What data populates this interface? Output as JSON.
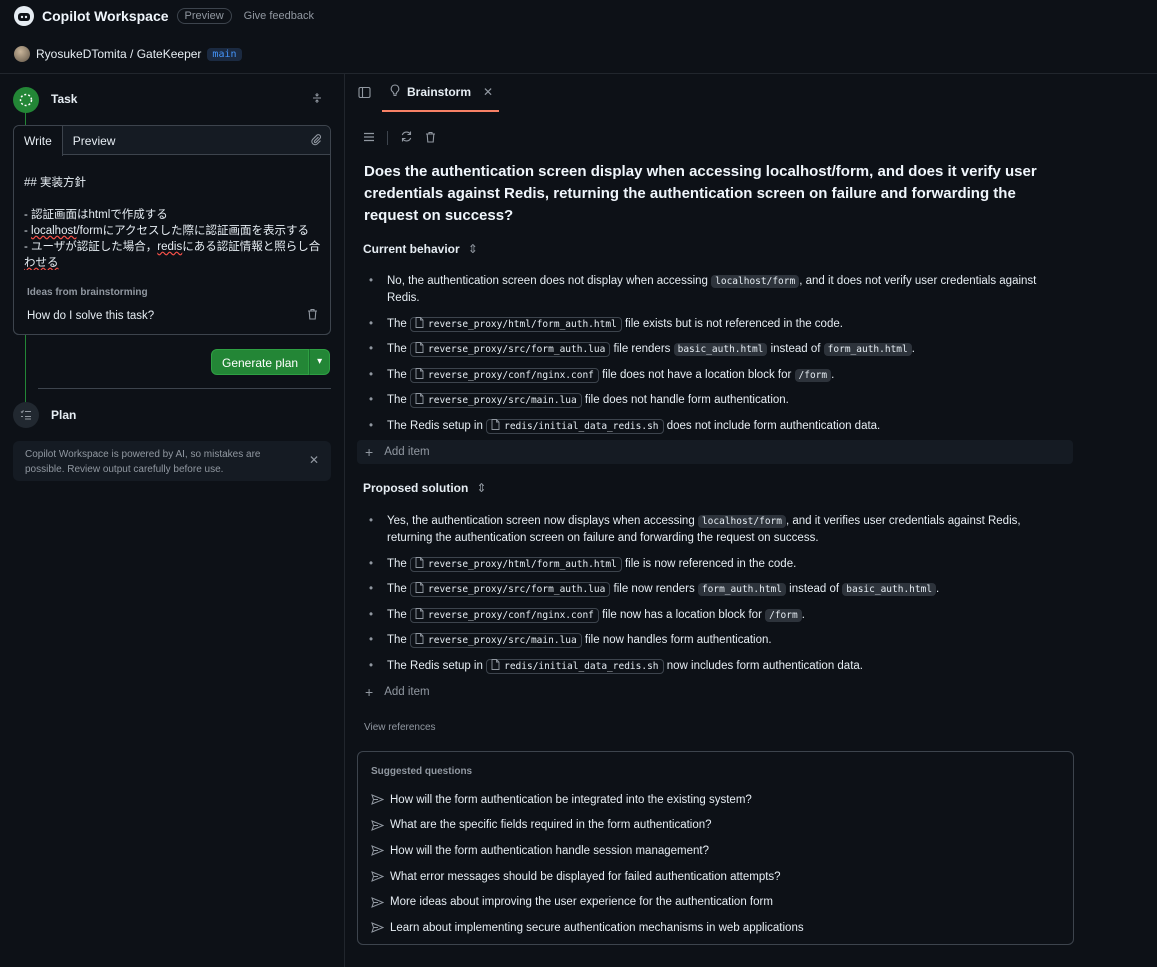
{
  "app": {
    "title": "Copilot Workspace",
    "badge": "Preview",
    "feedback": "Give feedback"
  },
  "repo": {
    "path": "RyosukeDTomita / GateKeeper",
    "branch": "main"
  },
  "task": {
    "label": "Task",
    "tabs": {
      "write": "Write",
      "preview": "Preview"
    },
    "lines": [
      "## 実装方針",
      "",
      "- 認証画面はhtmlで作成する",
      "- localhost/formにアクセスした際に認証画面を表示する",
      "- ユーザが認証した場合，redisにある認証情報と照らし合",
      "わせる"
    ],
    "ideas_title": "Ideas from brainstorming",
    "ideas_text": "How do I solve this task?",
    "generate": "Generate plan"
  },
  "plan": {
    "label": "Plan"
  },
  "notice": "Copilot Workspace is powered by AI, so mistakes are possible. Review output carefully before use.",
  "tab": {
    "label": "Brainstorm"
  },
  "question": "Does the authentication screen display when accessing localhost/form, and does it verify user credentials against Redis, returning the authentication screen on failure and forwarding the request on success?",
  "current": {
    "title": "Current behavior",
    "items": [
      [
        {
          "t": "No, the authentication screen does not display when accessing "
        },
        {
          "c": "localhost/form"
        },
        {
          "t": ", and it does not verify user credentials against Redis."
        }
      ],
      [
        {
          "t": "The "
        },
        {
          "f": "reverse_proxy/html/form_auth.html"
        },
        {
          "t": " file exists but is not referenced in the code."
        }
      ],
      [
        {
          "t": "The "
        },
        {
          "f": "reverse_proxy/src/form_auth.lua"
        },
        {
          "t": " file renders "
        },
        {
          "c": "basic_auth.html"
        },
        {
          "t": " instead of "
        },
        {
          "c": "form_auth.html"
        },
        {
          "t": "."
        }
      ],
      [
        {
          "t": "The "
        },
        {
          "f": "reverse_proxy/conf/nginx.conf"
        },
        {
          "t": " file does not have a location block for "
        },
        {
          "c": "/form"
        },
        {
          "t": "."
        }
      ],
      [
        {
          "t": "The "
        },
        {
          "f": "reverse_proxy/src/main.lua"
        },
        {
          "t": " file does not handle form authentication."
        }
      ],
      [
        {
          "t": "The Redis setup in "
        },
        {
          "f": "redis/initial_data_redis.sh"
        },
        {
          "t": " does not include form authentication data."
        }
      ]
    ],
    "add": "Add item"
  },
  "proposed": {
    "title": "Proposed solution",
    "items": [
      [
        {
          "t": "Yes, the authentication screen now displays when accessing "
        },
        {
          "c": "localhost/form"
        },
        {
          "t": ", and it verifies user credentials against Redis, returning the authentication screen on failure and forwarding the request on success."
        }
      ],
      [
        {
          "t": "The "
        },
        {
          "f": "reverse_proxy/html/form_auth.html"
        },
        {
          "t": " file is now referenced in the code."
        }
      ],
      [
        {
          "t": "The "
        },
        {
          "f": "reverse_proxy/src/form_auth.lua"
        },
        {
          "t": " file now renders "
        },
        {
          "c": "form_auth.html"
        },
        {
          "t": " instead of "
        },
        {
          "c": "basic_auth.html"
        },
        {
          "t": "."
        }
      ],
      [
        {
          "t": "The "
        },
        {
          "f": "reverse_proxy/conf/nginx.conf"
        },
        {
          "t": " file now has a location block for "
        },
        {
          "c": "/form"
        },
        {
          "t": "."
        }
      ],
      [
        {
          "t": "The "
        },
        {
          "f": "reverse_proxy/src/main.lua"
        },
        {
          "t": " file now handles form authentication."
        }
      ],
      [
        {
          "t": "The Redis setup in "
        },
        {
          "f": "redis/initial_data_redis.sh"
        },
        {
          "t": " now includes form authentication data."
        }
      ]
    ],
    "add": "Add item"
  },
  "view_refs": "View references",
  "suggested": {
    "title": "Suggested questions",
    "items": [
      "How will the form authentication be integrated into the existing system?",
      "What are the specific fields required in the form authentication?",
      "How will the form authentication handle session management?",
      "What error messages should be displayed for failed authentication attempts?",
      "More ideas about improving the user experience for the authentication form",
      "Learn about implementing secure authentication mechanisms in web applications"
    ]
  }
}
